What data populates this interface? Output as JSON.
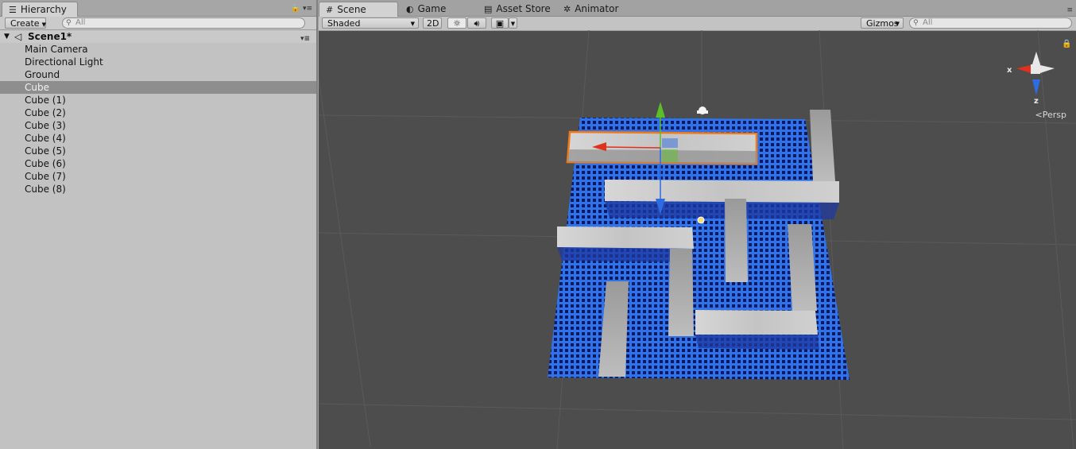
{
  "hierarchy": {
    "tab_label": "Hierarchy",
    "create_label": "Create",
    "search_placeholder": "All",
    "scene_name": "Scene1*",
    "items": [
      {
        "label": "Main Camera",
        "selected": false
      },
      {
        "label": "Directional Light",
        "selected": false
      },
      {
        "label": "Ground",
        "selected": false
      },
      {
        "label": "Cube",
        "selected": true
      },
      {
        "label": "Cube (1)",
        "selected": false
      },
      {
        "label": "Cube (2)",
        "selected": false
      },
      {
        "label": "Cube (3)",
        "selected": false
      },
      {
        "label": "Cube (4)",
        "selected": false
      },
      {
        "label": "Cube (5)",
        "selected": false
      },
      {
        "label": "Cube (6)",
        "selected": false
      },
      {
        "label": "Cube (7)",
        "selected": false
      },
      {
        "label": "Cube (8)",
        "selected": false
      }
    ]
  },
  "tabs": [
    {
      "label": "Scene",
      "icon": "scene-icon",
      "active": true
    },
    {
      "label": "Game",
      "icon": "game-icon",
      "active": false
    },
    {
      "label": "Asset Store",
      "icon": "asset-store-icon",
      "active": false
    },
    {
      "label": "Animator",
      "icon": "animator-icon",
      "active": false
    }
  ],
  "scene_toolbar": {
    "shading_mode": "Shaded",
    "mode_2d": "2D",
    "gizmos_label": "Gizmos",
    "search_placeholder": "All"
  },
  "gizmo": {
    "x_label": "x",
    "z_label": "z",
    "projection": "Persp"
  },
  "colors": {
    "selection_outline": "#f07a1a",
    "floor": "#2f72ea",
    "axis_x": "#e0301e",
    "axis_y": "#5cbf2a",
    "axis_z": "#2f6ce0"
  }
}
